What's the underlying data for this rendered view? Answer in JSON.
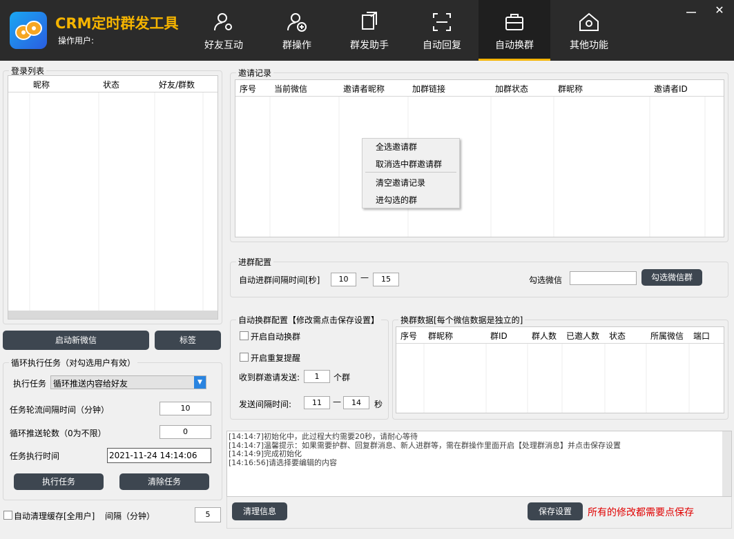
{
  "header": {
    "app_title": "CRM定时群发工具",
    "user_label": "操作用户:",
    "nav": [
      {
        "label": "好友互动",
        "icon": "user-settings-icon"
      },
      {
        "label": "群操作",
        "icon": "add-user-icon"
      },
      {
        "label": "群发助手",
        "icon": "send-document-icon"
      },
      {
        "label": "自动回复",
        "icon": "auto-reply-icon"
      },
      {
        "label": "自动换群",
        "icon": "briefcase-icon",
        "active": true
      },
      {
        "label": "其他功能",
        "icon": "home-gear-icon"
      }
    ],
    "minimize": "—",
    "close": "✕"
  },
  "login": {
    "title": "登录列表",
    "columns": [
      "昵称",
      "状态",
      "好友/群数"
    ]
  },
  "buttons": {
    "start_wechat": "启动新微信",
    "tag": "标签",
    "exec_task": "执行任务",
    "clear_task": "清除任务",
    "select_wechat_group": "勾选微信群",
    "clear_info": "清理信息",
    "save_settings": "保存设置"
  },
  "loop_task": {
    "title": "循环执行任务（对勾选用户有效）",
    "task_label": "执行任务",
    "task_value": "循环推送内容给好友",
    "interval_label": "任务轮流间隔时间（分钟）",
    "interval_value": "10",
    "rounds_label": "循环推送轮数（0为不限）",
    "rounds_value": "0",
    "time_label": "任务执行时间",
    "time_value": "2021-11-24 14:14:06"
  },
  "bottom_left": {
    "auto_clear_label": "自动清理缓存[全用户]",
    "interval_label": "间隔（分钟）",
    "interval_value": "5"
  },
  "invite": {
    "title": "邀请记录",
    "columns": [
      "序号",
      "当前微信",
      "邀请者昵称",
      "加群链接",
      "加群状态",
      "群昵称",
      "邀请者ID"
    ]
  },
  "context_menu": {
    "items": [
      "全选邀请群",
      "取消选中群邀请群",
      "清空邀请记录",
      "进勾选的群"
    ]
  },
  "join_config": {
    "title": "进群配置",
    "interval_label": "自动进群间隔时间[秒]",
    "min": "10",
    "dash": "—",
    "max": "15",
    "select_label": "勾选微信",
    "select_value": ""
  },
  "auto_switch": {
    "title": "自动换群配置【修改需点击保存设置】",
    "enable_label": "开启自动换群",
    "repeat_label": "开启重复提醒",
    "send_label": "收到群邀请发送:",
    "send_value": "1",
    "send_unit": "个群",
    "interval_label": "发送间隔时间:",
    "interval_min": "11",
    "dash": "—",
    "interval_max": "14",
    "unit": "秒"
  },
  "switch_data": {
    "title": "换群数据[每个微信数据是独立的]",
    "columns": [
      "序号",
      "群昵称",
      "群ID",
      "群人数",
      "已邀人数",
      "状态",
      "所属微信",
      "端口"
    ]
  },
  "log": {
    "lines": [
      "[14:14:7]初始化中，此过程大约需要20秒，请耐心等待",
      "[14:14:7]温馨提示：如果需要护群、回复群消息、新人进群等，需在群操作里面开启【处理群消息】并点击保存设置",
      "[14:14:9]完成初始化",
      "[14:16:56]请选择要编辑的内容"
    ]
  },
  "save_note": "所有的修改都需要点保存",
  "colors": {
    "header_bg": "#2b2b2b",
    "accent": "#f5b400",
    "button_bg": "#3d4650",
    "warning_text": "#e00000"
  }
}
